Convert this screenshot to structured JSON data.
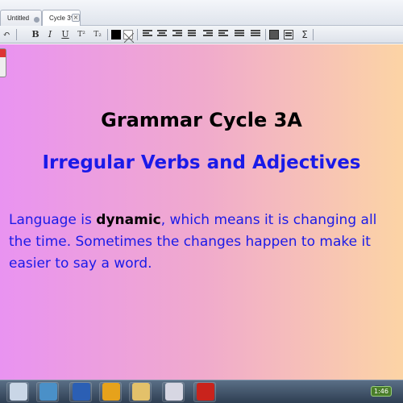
{
  "tabs": [
    {
      "label": "Untitled"
    },
    {
      "label": "Cycle 3*"
    }
  ],
  "toolbar": {
    "bold": "B",
    "italic": "I",
    "underline": "U",
    "superscript": "T²",
    "subscript": "T₂",
    "sum": "Σ"
  },
  "slide": {
    "title": "Grammar Cycle 3A",
    "subtitle": "Irregular Verbs and Adjectives",
    "body_before": "Language is ",
    "body_bold": "dynamic",
    "body_after": ", which means it is changing all the time. Sometimes the changes happen to make it easier to say a word."
  },
  "taskbar": {
    "clock": "1:46"
  },
  "colors": {
    "title": "#000000",
    "subtitle": "#1a1ae8",
    "body": "#1a1ae8"
  }
}
